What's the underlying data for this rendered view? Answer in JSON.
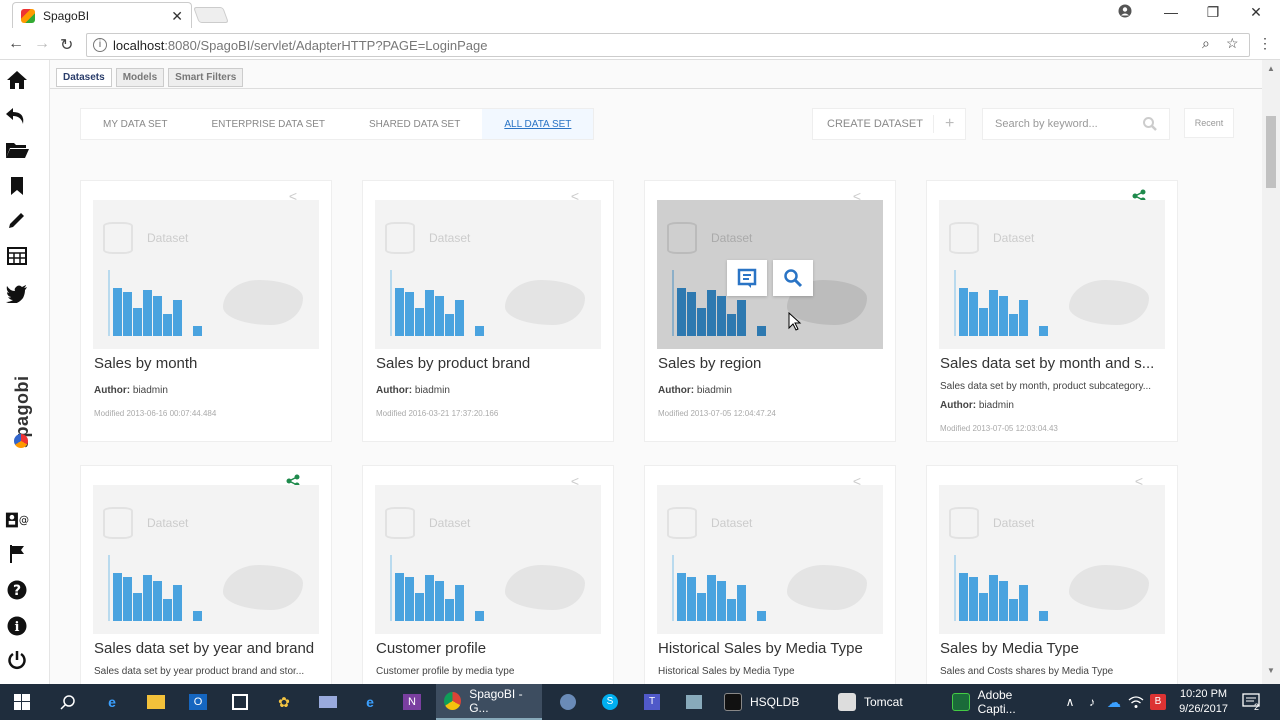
{
  "browser": {
    "tab_title": "SpagoBI",
    "tab_close": "✕",
    "url_host": "localhost",
    "url_path": ":8080/SpagoBI/servlet/AdapterHTTP?PAGE=LoginPage",
    "window_controls": [
      "—",
      "❐",
      "✕"
    ]
  },
  "sidebar": {
    "brand": "spagobi",
    "icons": [
      "home-icon",
      "undo-icon",
      "folder-icon",
      "bookmark-icon",
      "pencil-icon",
      "table-icon",
      "twitter-icon",
      "user-email-icon",
      "flag-icon",
      "help-icon",
      "info-icon",
      "power-icon"
    ]
  },
  "subtabs": [
    "Datasets",
    "Models",
    "Smart Filters"
  ],
  "filters": [
    "MY DATA SET",
    "ENTERPRISE DATA SET",
    "SHARED DATA SET",
    "ALL DATA SET"
  ],
  "toolbar": {
    "create_label": "CREATE DATASET",
    "create_plus": "+",
    "search_placeholder": "Search by keyword...",
    "recent_label": "Recent"
  },
  "thumb_label": "Dataset",
  "author_prefix": "Author:",
  "cards": [
    {
      "title": "Sales by month",
      "desc": "",
      "author": "biadmin",
      "modified": "Modified 2013-06-16 00:07:44.484",
      "shared": false
    },
    {
      "title": "Sales by product brand",
      "desc": "",
      "author": "biadmin",
      "modified": "Modified 2016-03-21 17:37:20.166",
      "shared": false
    },
    {
      "title": "Sales by region",
      "desc": "",
      "author": "biadmin",
      "modified": "Modified 2013-07-05 12:04:47.24",
      "shared": false
    },
    {
      "title": "Sales data set by month and s...",
      "desc": "Sales data set by month, product subcategory...",
      "author": "biadmin",
      "modified": "Modified 2013-07-05 12:03:04.43",
      "shared": true
    },
    {
      "title": "Sales data set by year and brand",
      "desc": "Sales data set by year product brand and stor...",
      "shared": true
    },
    {
      "title": "Customer profile",
      "desc": "Customer profile by media type",
      "shared": false
    },
    {
      "title": "Historical Sales by Media Type",
      "desc": "Historical Sales by Media Type",
      "shared": false
    },
    {
      "title": "Sales by Media Type",
      "desc": "Sales and Costs shares by Media Type",
      "shared": false
    }
  ],
  "taskbar": {
    "apps": [
      {
        "label": "SpagoBI - G..."
      },
      {
        "label": "HSQLDB"
      },
      {
        "label": "Tomcat"
      },
      {
        "label": "Adobe Capti..."
      }
    ],
    "time": "10:20 PM",
    "date": "9/26/2017",
    "notif_count": "2"
  },
  "colors": {
    "accent_blue": "#2a74c5",
    "share_green": "#1f8a4c",
    "bar_blue": "#4aa3df"
  }
}
